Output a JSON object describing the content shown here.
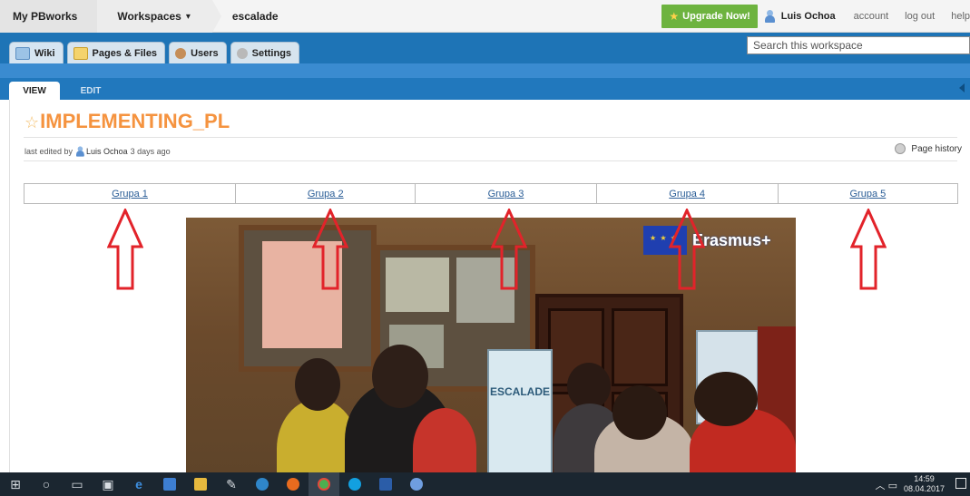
{
  "topnav": {
    "crumbs": [
      "My PBworks",
      "Workspaces",
      "escalade"
    ],
    "upgrade": "Upgrade Now!",
    "user": "Luis Ochoa",
    "links": [
      "account",
      "log out",
      "help"
    ]
  },
  "tabs": {
    "items": [
      "Wiki",
      "Pages & Files",
      "Users",
      "Settings"
    ]
  },
  "search": {
    "placeholder": "Search this workspace"
  },
  "mode_tabs": {
    "view": "VIEW",
    "edit": "EDIT"
  },
  "page": {
    "title": "IMPLEMENTING_PL",
    "meta_prefix": "last edited by",
    "meta_user": "Luis Ochoa",
    "meta_suffix": "3 days ago",
    "history": "Page history"
  },
  "groups": [
    "Grupa 1",
    "Grupa 2",
    "Grupa 3",
    "Grupa 4",
    "Grupa 5"
  ],
  "photo": {
    "logo_text": "Erasmus+",
    "poster_text": "ESCALADE"
  },
  "taskbar": {
    "icons": [
      "windows-start-icon",
      "search-icon",
      "task-view-icon",
      "store-icon",
      "edge-icon",
      "save-icon",
      "file-explorer-icon",
      "pen-icon",
      "app-icon",
      "firefox-icon",
      "chrome-icon",
      "skype-icon",
      "word-icon",
      "media-icon"
    ],
    "time": "14:59",
    "date": "08.04.2017"
  },
  "colors": {
    "accent_blue": "#1e74b6",
    "title_orange": "#f5933f",
    "upgrade_green": "#6db33f",
    "arrow_red": "#e2232a"
  }
}
